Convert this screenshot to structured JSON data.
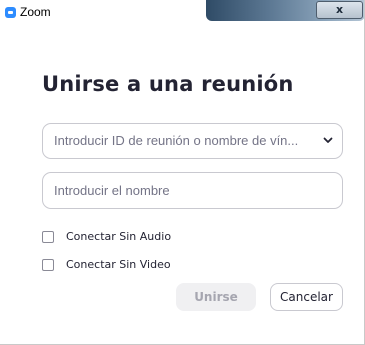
{
  "window": {
    "title": "Zoom",
    "app_icon": "zoom-logo-icon",
    "close_icon": "close-icon",
    "close_glyph": "x"
  },
  "dialog": {
    "heading": "Unirse a una reunión",
    "meeting_select": {
      "placeholder": "Introducir ID de reunión o nombre de vín...",
      "icon": "chevron-down-icon"
    },
    "name_input": {
      "value": "",
      "placeholder": "Introducir el nombre"
    },
    "options": [
      {
        "label": "Conectar Sin Audio",
        "checked": false
      },
      {
        "label": "Conectar Sin Video",
        "checked": false
      }
    ],
    "join_label": "Unirse",
    "cancel_label": "Cancelar"
  },
  "colors": {
    "accent": "#2d8cff",
    "text": "#232333",
    "placeholder": "#747487",
    "border": "#c9c9d0",
    "disabled_bg": "#f0f0f2",
    "disabled_text": "#a6a6b0"
  }
}
